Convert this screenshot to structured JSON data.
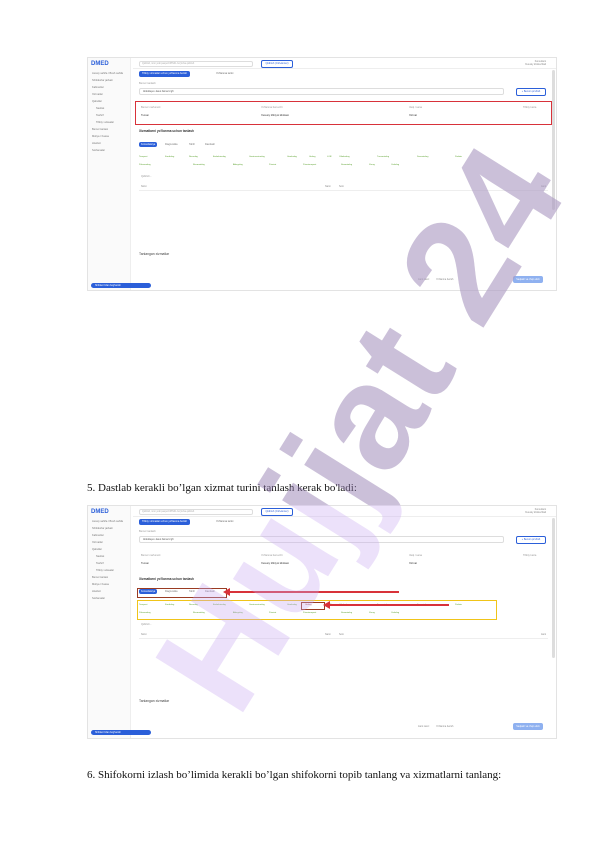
{
  "app": {
    "logo": "DMED",
    "search_placeholder": "Qidirish, ismi yoki pasport/PINFL bo'yicha qidirish",
    "search_button": "Qidirish (Ctrl+Enter)",
    "user": "Konsultant",
    "user_org": "Xususiy klinika filiali",
    "sidebar": [
      "Asosiy sahifa / Bosh sahifa",
      "Shifokorlar jadvali",
      "Kabinetlar",
      "Xizmatlar",
      "Qabullar",
      "Navbat",
      "Tashrif",
      "Tibbiy xulosalar",
      "Bemor kartasi",
      "Moliya / Kassa",
      "Hisobot",
      "Sozlamalar"
    ],
    "tab_active": "Tibbiy xizmatlar uchun yo'llanma berish",
    "tab_inactive": "Yo'llanma tarixi",
    "patient_label": "Bemor tanlash",
    "patient_value": "Abdullayev Jasur Akmal o'g'li",
    "add_button": "+ Bemor qo'shish",
    "fields_labels": [
      "Bemor ma'lumoti",
      "Yo'llanma beruvchi",
      "Vaqt / sana",
      "Tibbiy karta"
    ],
    "fields_values": [
      "Tuman",
      "Xususiy tibbiyot klinikasi",
      "Xizmat"
    ],
    "section_title": "Xizmatlarni yo'llanma uchun tanlash",
    "service_tabs": [
      "Konsultatsiya",
      "Diagnostika",
      "Tahlil",
      "Davolash"
    ],
    "chips_row1": [
      "Terapevt",
      "Kardiolog",
      "Nevrolog",
      "Endokrinolog",
      "Gastroenterolog",
      "Ginekolog",
      "Urolog",
      "LOR",
      "Oftalmolog",
      "Travmatolog",
      "Dermatolog",
      "Pediatr"
    ],
    "chips_row2": [
      "Pulmonolog",
      "Revmatolog",
      "Allergolog",
      "Psixiatr",
      "Psixoterapevt",
      "Stomatolog",
      "Xirurg",
      "Onkolog"
    ],
    "search_small": "Qidirish...",
    "table_headers": [
      "Nomi",
      "Narxi",
      "Soni",
      "Jami"
    ],
    "footer_title": "Tanlangan xizmatlar",
    "pager_text": "Jami narxi:",
    "pager_check": "Yo'llanma berish",
    "save_button": "Saqlash va chop etish",
    "bottom_pill": "Shifokor bilan bog'lanish"
  },
  "captions": {
    "step5": "5. Dastlab kerakli bo’lgan xizmat turini tanlash kerak bo'ladi:",
    "step6": "6. Shifokorni izlash bo’limida kerakli bo’lgan shifokorni topib tanlang va xizmatlarni tanlang:"
  },
  "watermark": "Hujjat 24",
  "colors": {
    "accent": "#2b5fd9",
    "highlight_red": "#d8323a",
    "highlight_yellow": "#f0c419",
    "chip_green": "#5aa02c",
    "watermark_gray": "#888888",
    "watermark_purple": "#c9a8f0"
  }
}
